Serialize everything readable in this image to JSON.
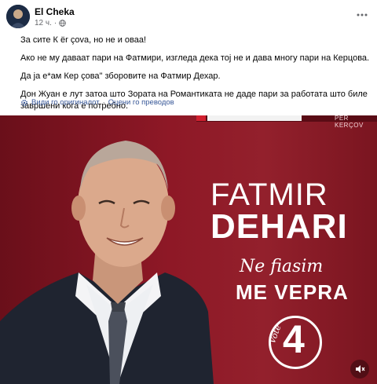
{
  "post": {
    "author": "El Cheka",
    "time": "12 ч.",
    "paragraphs": [
      "За сите К ёr çova, но не и оваа!",
      "Ако не му даваат пари на Фатмири, изгледа дека тој не и дава многу пари на Керцова.",
      "Да ја е*ам Кер çова\" зборовите на Фатмир Дехар.",
      "Дон Жуан е лут затоа што Зората на Романтиката не даде пари за работата што биле завршени кога е потребно."
    ],
    "see_original": "Види го оригиналот",
    "separator": "·",
    "rate_translation": "Оцени го преводов"
  },
  "poster": {
    "top_tag": "PER KERÇOV",
    "first_name": "FATMIR",
    "last_name": "DEHARI",
    "motto_script": "Ne fiasim",
    "motto_main": "ME VEPRA",
    "vote_label": "Vote",
    "vote_number": "4"
  },
  "colors": {
    "poster_red": "#8e1826",
    "link_blue": "#385898",
    "muted_gray": "#65676b"
  },
  "icons": {
    "privacy": "globe-icon",
    "more": "more-dots-icon",
    "translate": "translate-gear-icon",
    "audio": "mute-speaker-icon"
  }
}
